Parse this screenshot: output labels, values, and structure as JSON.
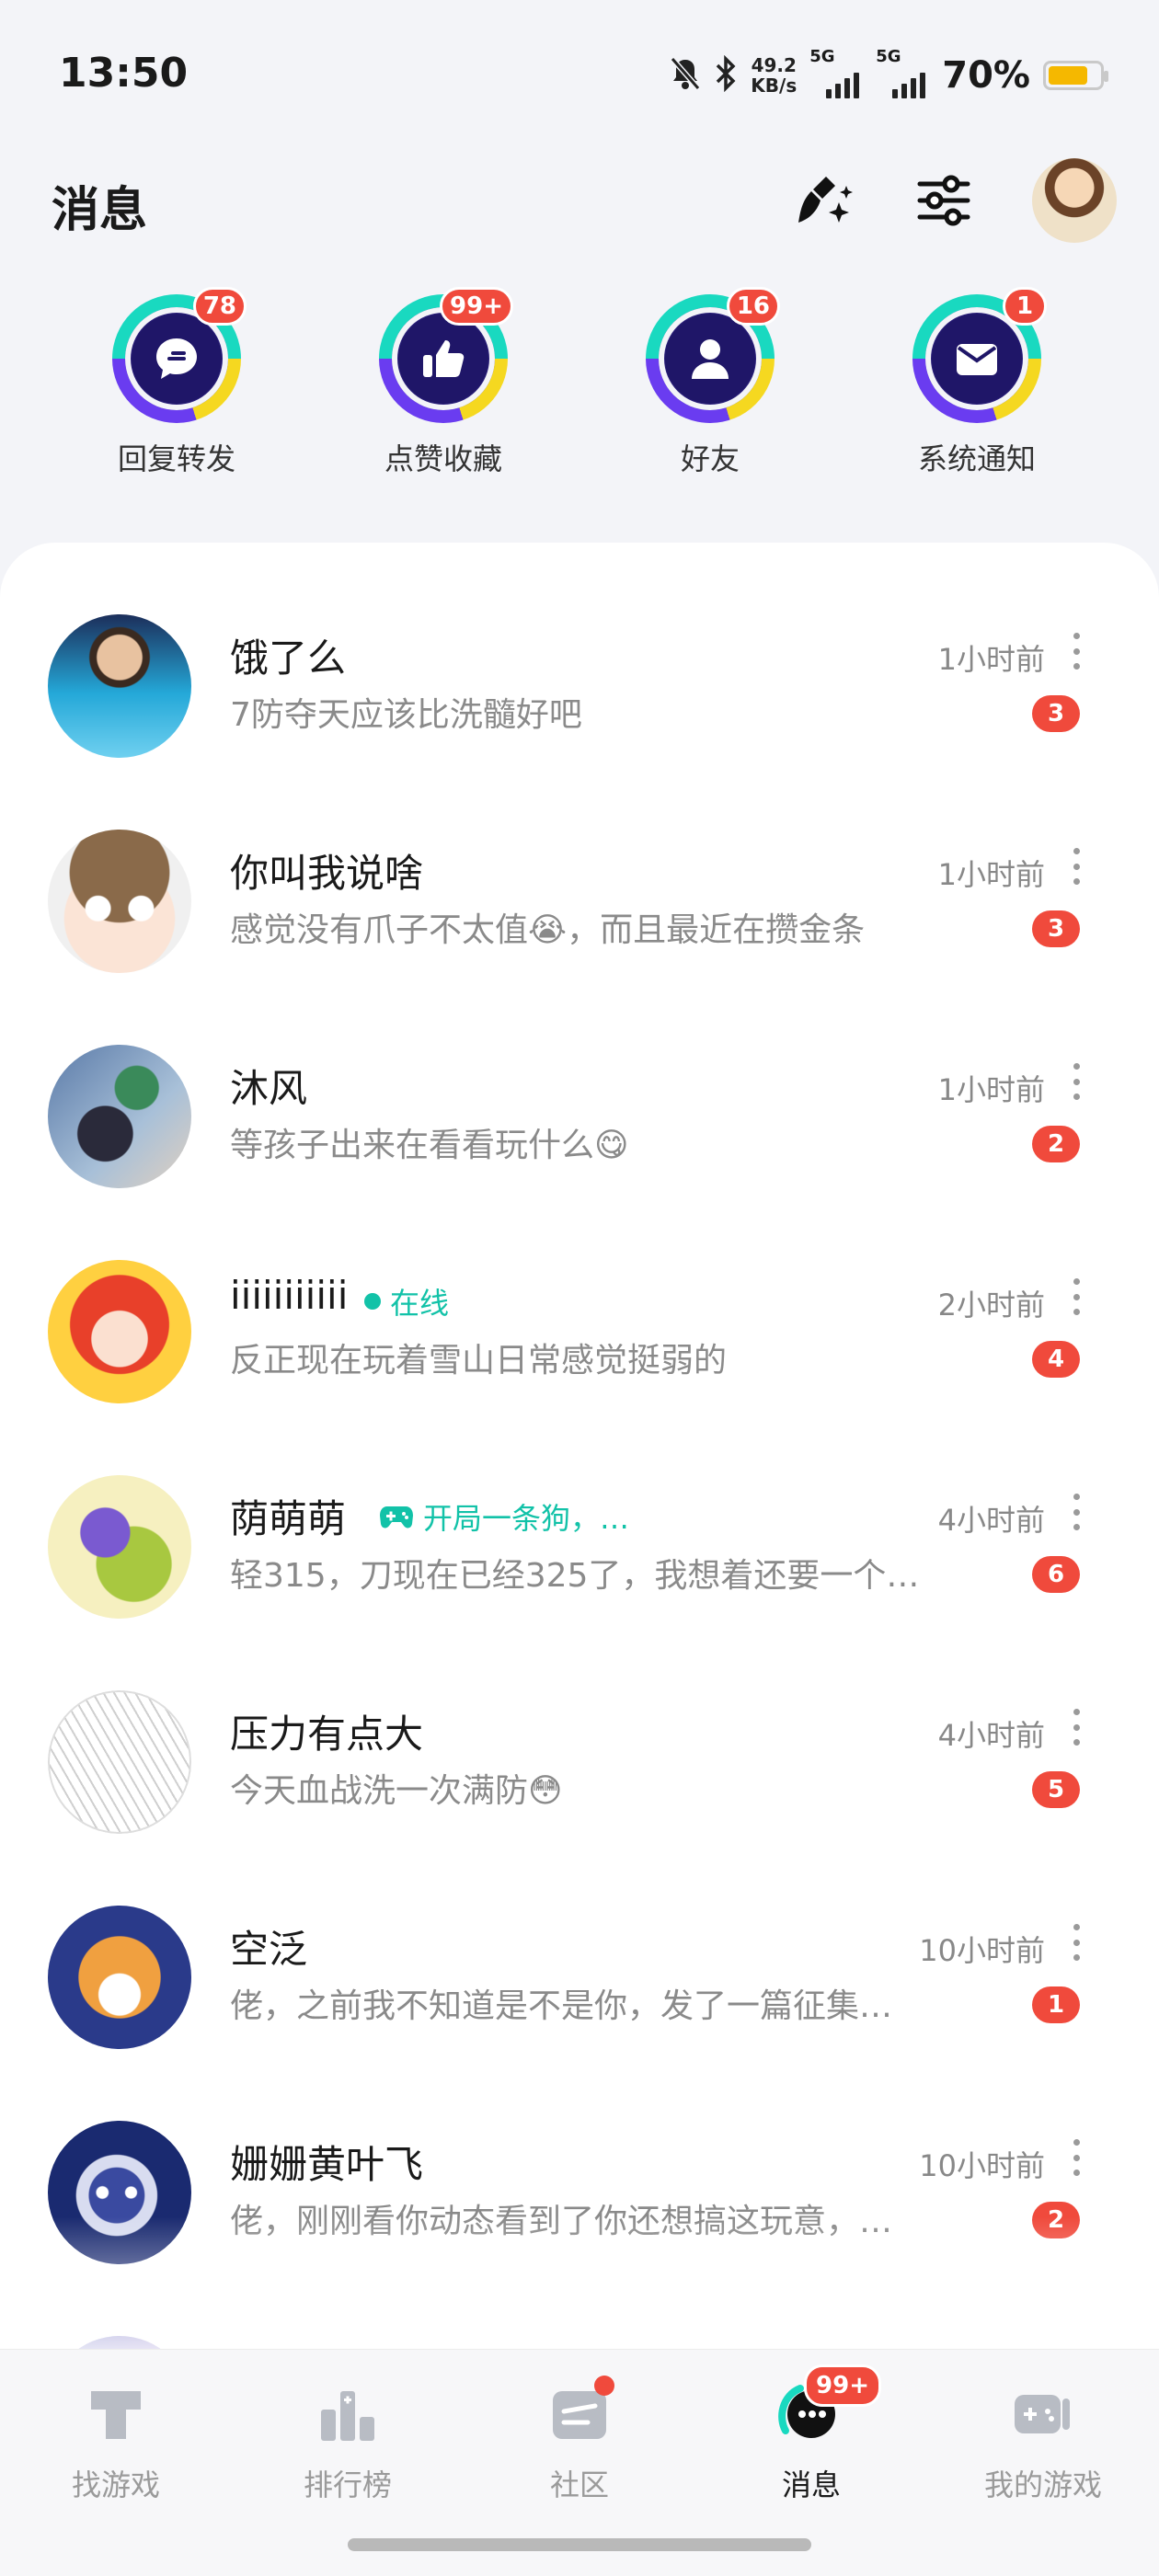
{
  "status_bar": {
    "time": "13:50",
    "net_speed_value": "49.2",
    "net_speed_unit": "KB/s",
    "sim1": "5G",
    "sim2": "5G",
    "battery_percent": "70%",
    "battery_level": 0.7
  },
  "header": {
    "title": "消息"
  },
  "categories": [
    {
      "label": "回复转发",
      "badge": "78",
      "icon": "chat-bubble-icon"
    },
    {
      "label": "点赞收藏",
      "badge": "99+",
      "icon": "thumbs-up-icon"
    },
    {
      "label": "好友",
      "badge": "16",
      "icon": "person-icon"
    },
    {
      "label": "系统通知",
      "badge": "1",
      "icon": "envelope-icon"
    }
  ],
  "conversations": [
    {
      "name": "饿了么",
      "preview": "7防夺天应该比洗髓好吧",
      "time": "1小时前",
      "unread": "3"
    },
    {
      "name": "你叫我说啥",
      "preview": "感觉没有爪子不太值😭，而且最近在攒金条",
      "time": "1小时前",
      "unread": "3"
    },
    {
      "name": "沐风",
      "preview": "等孩子出来在看看玩什么😋",
      "time": "1小时前",
      "unread": "2"
    },
    {
      "name": "iiiiiiiiiii",
      "status": "在线",
      "preview": "反正现在玩着雪山日常感觉挺弱的",
      "time": "2小时前",
      "unread": "4"
    },
    {
      "name": "荫萌萌",
      "status": "开局一条狗，…",
      "preview": "轻315，刀现在已经325了，我想着还要一个…",
      "time": "4小时前",
      "unread": "6"
    },
    {
      "name": "压力有点大",
      "preview": "今天血战洗一次满防😳",
      "time": "4小时前",
      "unread": "5"
    },
    {
      "name": "空泛",
      "preview": "佬，之前我不知道是不是你，发了一篇征集…",
      "time": "10小时前",
      "unread": "1"
    },
    {
      "name": "姗姗黄叶飞",
      "preview": "佬，刚刚看你动态看到了你还想搞这玩意，…",
      "time": "10小时前",
      "unread": "2"
    }
  ],
  "bottom_nav": [
    {
      "label": "找游戏"
    },
    {
      "label": "排行榜"
    },
    {
      "label": "社区"
    },
    {
      "label": "消息",
      "badge": "99+"
    },
    {
      "label": "我的游戏"
    }
  ],
  "colors": {
    "accent": "#12c2a8",
    "badge_red": "#f04a3c",
    "icon_navy": "#1f1668"
  }
}
